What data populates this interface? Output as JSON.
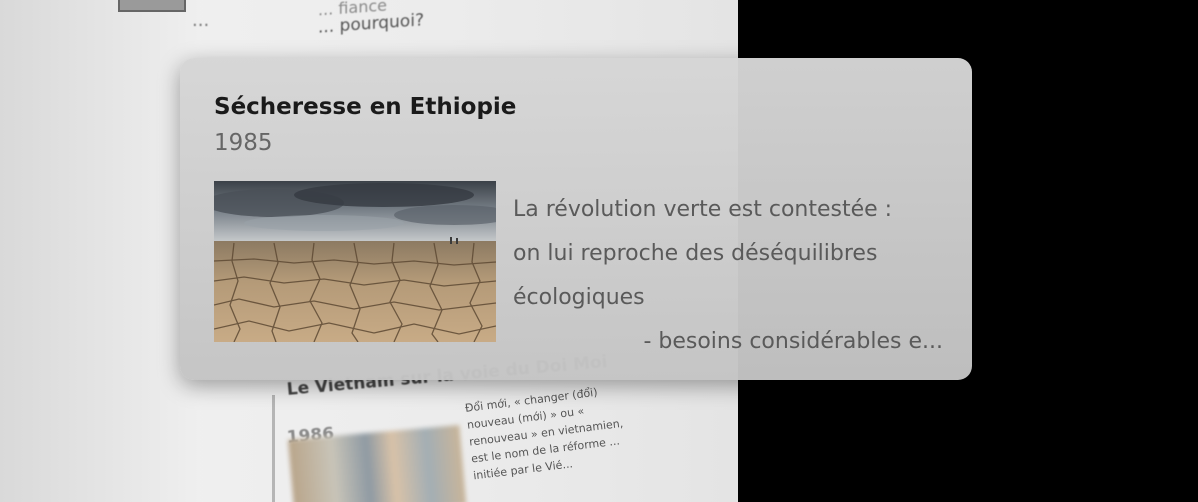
{
  "background_page": {
    "top_snippet_line1": "... fiance",
    "top_snippet_line2": "... pourquoi?",
    "top_ellipsis": "...",
    "entry2": {
      "title": "Le Vietnam sur la voie du Doi Moi",
      "year": "1986",
      "excerpt": "Đổi mới, « changer (đổi) nouveau (mới) » ou « renouveau » en vietnamien, est le nom de la réforme ... initiée par le Vié..."
    }
  },
  "card": {
    "title": "Sécheresse en Ethiopie",
    "year": "1985",
    "image_icon": "drought-landscape-image",
    "excerpt_lines": [
      "La révolution verte est contestée :",
      "on lui reproche des déséquilibres",
      "écologiques",
      "- besoins considérables e..."
    ]
  }
}
